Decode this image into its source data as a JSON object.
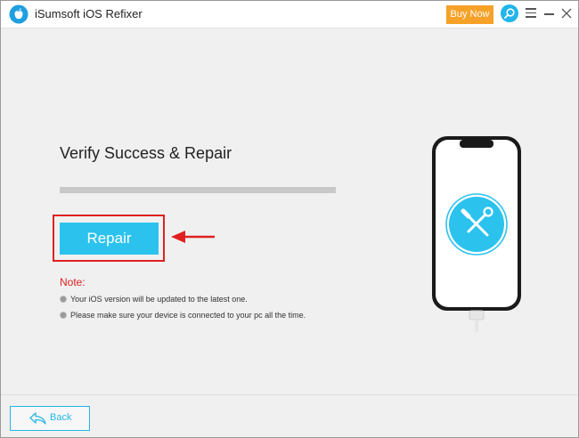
{
  "app": {
    "title": "iSumsoft iOS Refixer"
  },
  "titlebar": {
    "buy_label": "Buy Now",
    "icons": [
      "app-logo-icon",
      "search-icon",
      "menu-icon",
      "minimize-icon",
      "close-icon"
    ]
  },
  "main": {
    "heading": "Verify Success & Repair",
    "progress_fraction": 1.0,
    "repair_label": "Repair",
    "note_title": "Note:",
    "notes": [
      "Your iOS version will be updated to the latest one.",
      "Please make sure your device is connected to your pc all the time."
    ]
  },
  "footer": {
    "back_label": "Back"
  },
  "colors": {
    "accent": "#2bc3ee",
    "buy": "#f6a128",
    "highlight": "#e02020",
    "note_title": "#e02020"
  }
}
